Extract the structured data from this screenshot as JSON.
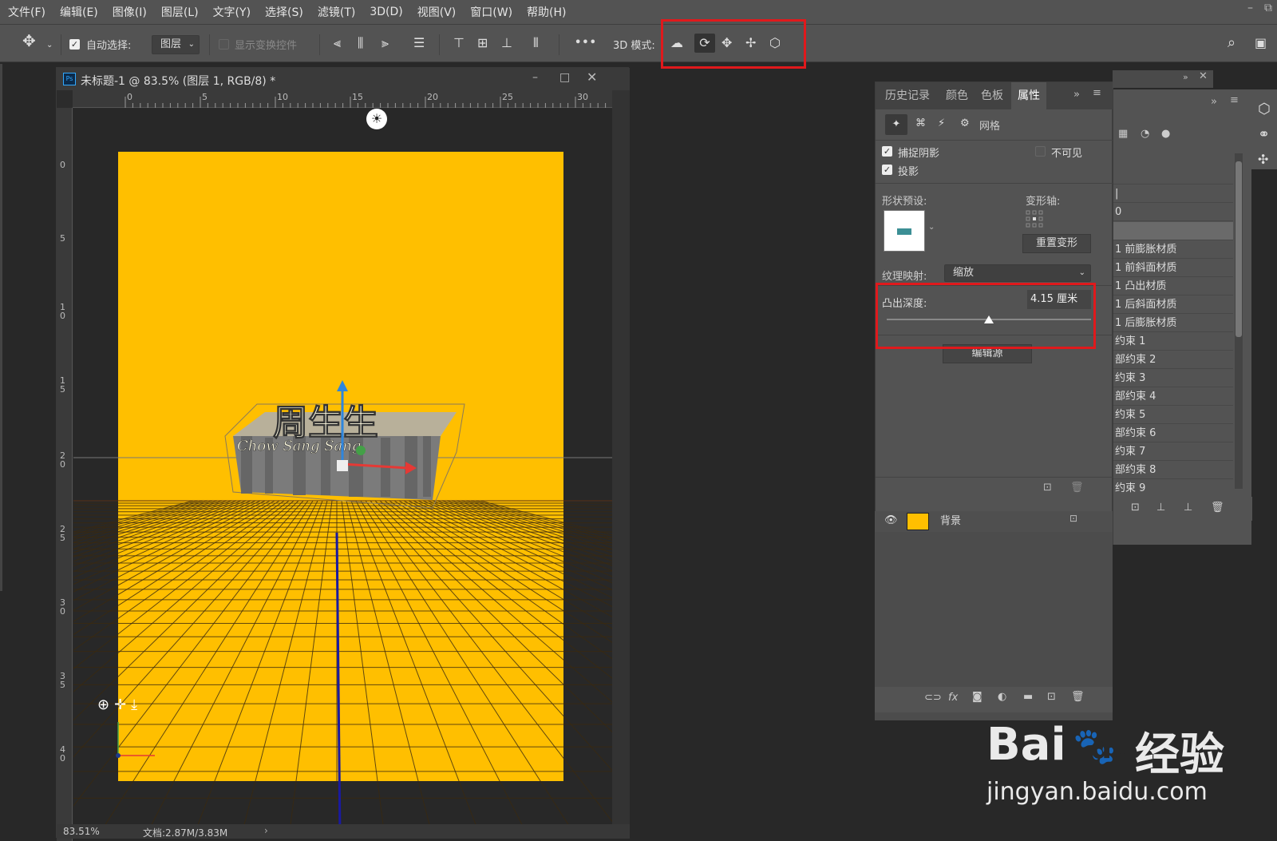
{
  "menubar": {
    "items": [
      "文件(F)",
      "编辑(E)",
      "图像(I)",
      "图层(L)",
      "文字(Y)",
      "选择(S)",
      "滤镜(T)",
      "3D(D)",
      "视图(V)",
      "窗口(W)",
      "帮助(H)"
    ],
    "win_minimize": "–",
    "win_restore": "⧉"
  },
  "options": {
    "auto_select_label": "自动选择:",
    "auto_select_checked": true,
    "layer_dropdown": "图层",
    "show_transform_label": "显示变换控件",
    "more_label": "•••",
    "mode_3d_label": "3D 模式:"
  },
  "document": {
    "title": "未标题-1 @ 83.5% (图层 1, RGB/8) *",
    "ps_badge": "Ps",
    "zoom": "83.51%",
    "doc_size": "文档:2.87M/3.83M",
    "ruler_top": [
      "0",
      "5",
      "10",
      "15",
      "20",
      "25",
      "30"
    ],
    "ruler_left": [
      "0",
      "5",
      "1 0",
      "1 5",
      "2 0",
      "2 5",
      "3 0",
      "3 5",
      "4 0"
    ],
    "canvas_color": "#ffbf00",
    "text_main": "周生生",
    "text_sub": "Chow Sang Sang"
  },
  "properties": {
    "tabs": [
      "历史记录",
      "颜色",
      "色板",
      "属性"
    ],
    "active_tab": "属性",
    "tab_more": "»",
    "mesh_label": "网格",
    "catch_shadow_label": "捕捉阴影",
    "cast_shadow_label": "投影",
    "invisible_label": "不可见",
    "shape_preset_label": "形状预设:",
    "deform_axis_label": "变形轴:",
    "reset_deform_label": "重置变形",
    "texture_map_label": "纹理映射:",
    "texture_map_value": "缩放",
    "extrude_depth_label": "凸出深度:",
    "extrude_depth_value": "4.15 厘米",
    "extrude_slider_fraction": 0.5,
    "edit_source_label": "编辑源"
  },
  "layers": {
    "background_label": "背景"
  },
  "right_panel": {
    "row_value": "0",
    "items": [
      "1 前膨胀材质",
      "1 前斜面材质",
      "1 凸出材质",
      "1 后斜面材质",
      "1 后膨胀材质",
      "约束 1",
      "部约束 2",
      "约束 3",
      "部约束 4",
      "约束 5",
      "部约束 6",
      "约束 7",
      "部约束 8",
      "约束 9"
    ]
  },
  "watermark": {
    "brand": "Bai",
    "brand2": "du",
    "cn": "经验",
    "url": "jingyan.baidu.com"
  }
}
